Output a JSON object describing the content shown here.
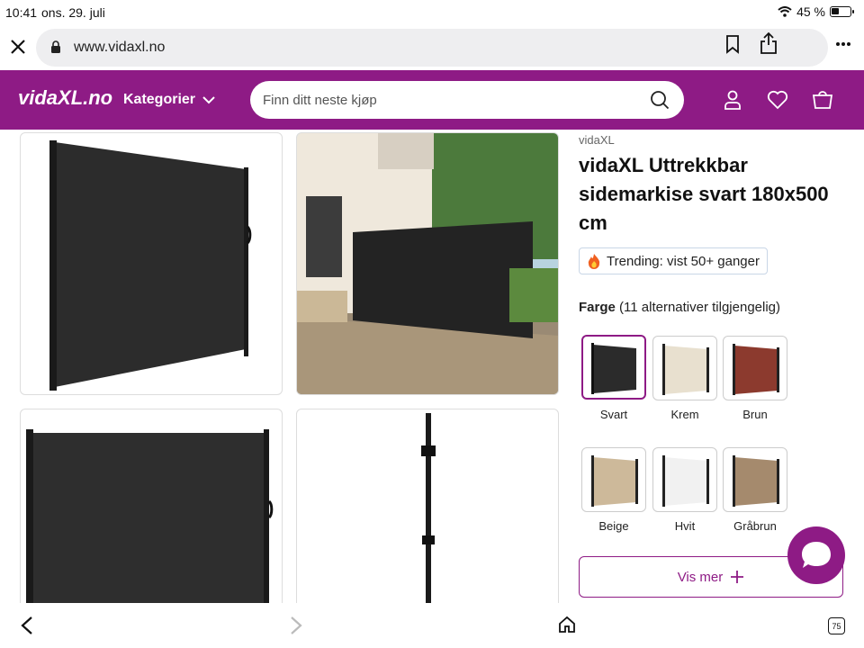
{
  "status": {
    "time": "10:41",
    "date": "ons. 29. juli",
    "battery": "45 %"
  },
  "browser": {
    "url": "www.vidaxl.no",
    "tab_count": "75"
  },
  "header": {
    "logo": "vidaXL.no",
    "categories_label": "Kategorier",
    "search_placeholder": "Finn ditt neste kjøp"
  },
  "product": {
    "brand": "vidaXL",
    "title": "vidaXL Uttrekkbar sidemarkise svart 180x500 cm",
    "trending": "Trending: vist 50+ ganger",
    "color_label": "Farge",
    "color_count": "(11 alternativer tilgjengelig)",
    "colors": [
      {
        "label": "Svart",
        "hex": "#2b2b2b"
      },
      {
        "label": "Krem",
        "hex": "#e8e0cf"
      },
      {
        "label": "Brun",
        "hex": "#8c3a2e"
      },
      {
        "label": "Beige",
        "hex": "#cdb99a"
      },
      {
        "label": "Hvit",
        "hex": "#f1f1f1"
      },
      {
        "label": "Gråbrun",
        "hex": "#a58a6d"
      }
    ],
    "show_more": "Vis mer"
  },
  "colors": {
    "brand": "#8e1b85"
  }
}
